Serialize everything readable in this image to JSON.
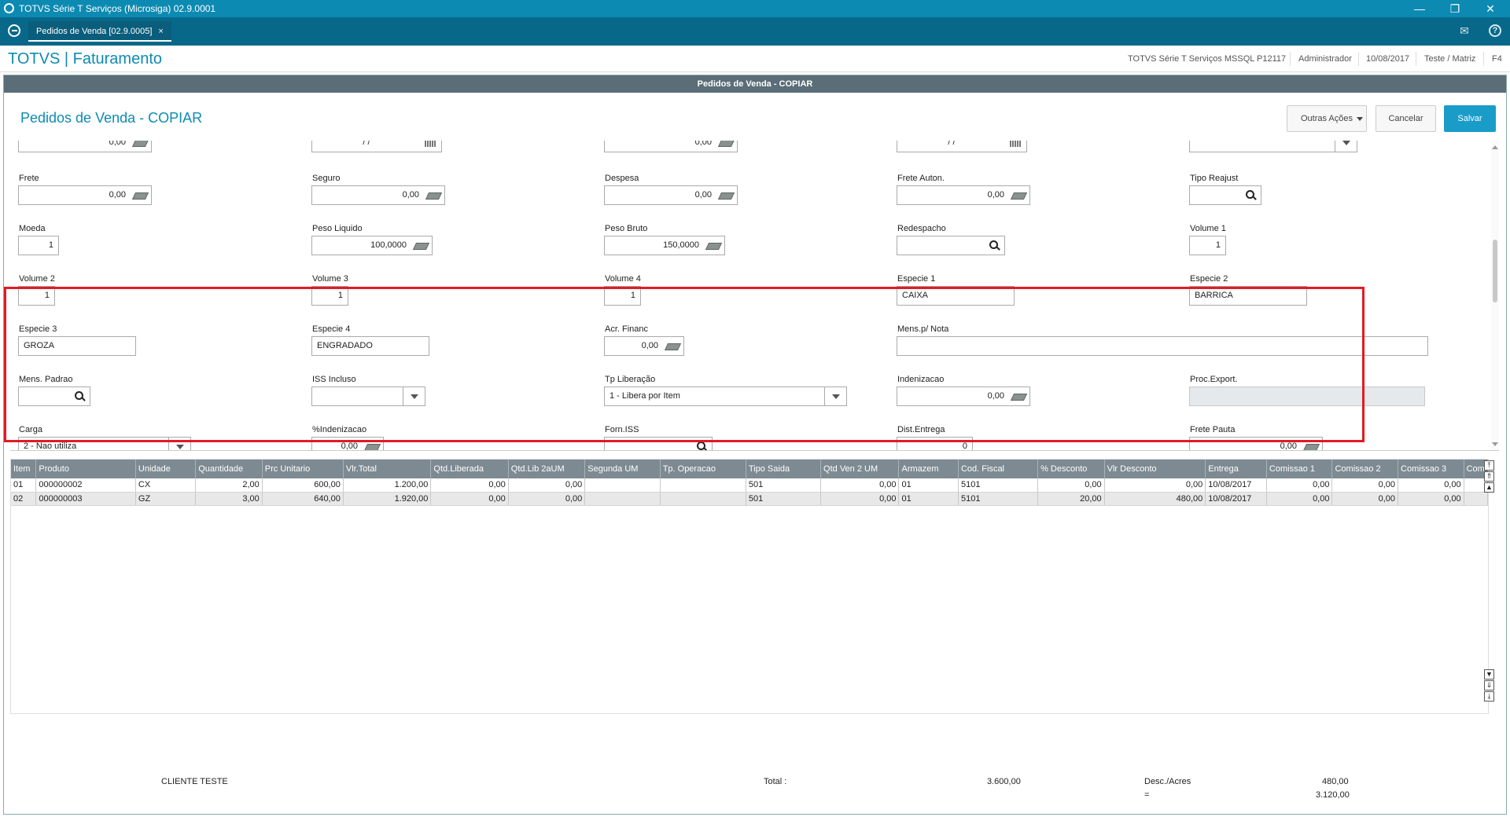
{
  "window": {
    "title": "TOTVS Série T Serviços (Microsiga) 02.9.0001",
    "minimize": "—",
    "restore": "❐",
    "close": "✕"
  },
  "tabs": [
    {
      "label": "Pedidos de Venda [02.9.0005]",
      "close": "×"
    }
  ],
  "topbar_icons": {
    "mail": "✉",
    "help": "?"
  },
  "header": {
    "app_title": "TOTVS | Faturamento",
    "environment": "TOTVS Série T Serviços MSSQL P12117",
    "user": "Administrador",
    "date": "10/08/2017",
    "branch": "Teste / Matriz",
    "key": "F4"
  },
  "dialog": {
    "titlebar": "Pedidos de Venda - COPIAR",
    "title": "Pedidos de Venda - COPIAR",
    "buttons": {
      "other": "Outras Ações",
      "cancel": "Cancelar",
      "save": "Salvar"
    }
  },
  "form": {
    "row0": {
      "f1": "0,00",
      "f2": "/ /",
      "f3": "0,00",
      "f4": "/ /",
      "f5": ""
    },
    "frete": {
      "label": "Frete",
      "value": "0,00"
    },
    "seguro": {
      "label": "Seguro",
      "value": "0,00"
    },
    "despesa": {
      "label": "Despesa",
      "value": "0,00"
    },
    "frete_auton": {
      "label": "Frete Auton.",
      "value": "0,00"
    },
    "tipo_reajust": {
      "label": "Tipo Reajust",
      "value": ""
    },
    "moeda": {
      "label": "Moeda",
      "value": "1"
    },
    "peso_liquido": {
      "label": "Peso Liquido",
      "value": "100,0000"
    },
    "peso_bruto": {
      "label": "Peso Bruto",
      "value": "150,0000"
    },
    "redespacho": {
      "label": "Redespacho",
      "value": ""
    },
    "volume1": {
      "label": "Volume 1",
      "value": "1"
    },
    "volume2": {
      "label": "Volume 2",
      "value": "1"
    },
    "volume3": {
      "label": "Volume 3",
      "value": "1"
    },
    "volume4": {
      "label": "Volume 4",
      "value": "1"
    },
    "especie1": {
      "label": "Especie 1",
      "value": "CAIXA"
    },
    "especie2": {
      "label": "Especie 2",
      "value": "BARRICA"
    },
    "especie3": {
      "label": "Especie 3",
      "value": "GROZA"
    },
    "especie4": {
      "label": "Especie 4",
      "value": "ENGRADADO"
    },
    "acr_financ": {
      "label": "Acr. Financ",
      "value": "0,00"
    },
    "mens_nota": {
      "label": "Mens.p/ Nota",
      "value": ""
    },
    "mens_padrao": {
      "label": "Mens. Padrao",
      "value": ""
    },
    "iss_incluso": {
      "label": "ISS Incluso",
      "value": ""
    },
    "tp_liberacao": {
      "label": "Tp Liberação",
      "value": "1 - Libera por Item"
    },
    "indenizacao": {
      "label": "Indenizacao",
      "value": "0,00"
    },
    "proc_export": {
      "label": "Proc.Export.",
      "value": ""
    },
    "carga": {
      "label": "Carga",
      "value": "2 - Nao utiliza"
    },
    "pct_indenizacao": {
      "label": "%Indenizacao",
      "value": "0,00"
    },
    "forn_iss": {
      "label": "Forn.ISS",
      "value": ""
    },
    "dist_entrega": {
      "label": "Dist.Entrega",
      "value": "0"
    },
    "frete_pauta": {
      "label": "Frete Pauta",
      "value": "0,00"
    }
  },
  "grid": {
    "columns": [
      "Item",
      "Produto",
      "Unidade",
      "Quantidade",
      "Prc Unitario",
      "Vlr.Total",
      "Qtd.Liberada",
      "Qtd.Lib 2aUM",
      "Segunda UM",
      "Tp. Operacao",
      "Tipo Saida",
      "Qtd Ven 2 UM",
      "Armazem",
      "Cod. Fiscal",
      "% Desconto",
      "Vlr Desconto",
      "Entrega",
      "Comissao 1",
      "Comissao 2",
      "Comissao 3",
      "Com"
    ],
    "rows": [
      [
        "01",
        "000000002",
        "CX",
        "2,00",
        "600,00",
        "1.200,00",
        "0,00",
        "0,00",
        "",
        "",
        "501",
        "0,00",
        "01",
        "5101",
        "0,00",
        "0,00",
        "10/08/2017",
        "0,00",
        "0,00",
        "0,00",
        ""
      ],
      [
        "02",
        "000000003",
        "GZ",
        "3,00",
        "640,00",
        "1.920,00",
        "0,00",
        "0,00",
        "",
        "",
        "501",
        "0,00",
        "01",
        "5101",
        "20,00",
        "480,00",
        "10/08/2017",
        "0,00",
        "0,00",
        "0,00",
        ""
      ]
    ]
  },
  "footer": {
    "client": "CLIENTE TESTE",
    "total_label": "Total :",
    "total_value": "3.600,00",
    "desc_label": "Desc./Acres",
    "desc_value": "480,00",
    "eq_label": "=",
    "eq_value": "3.120,00"
  }
}
